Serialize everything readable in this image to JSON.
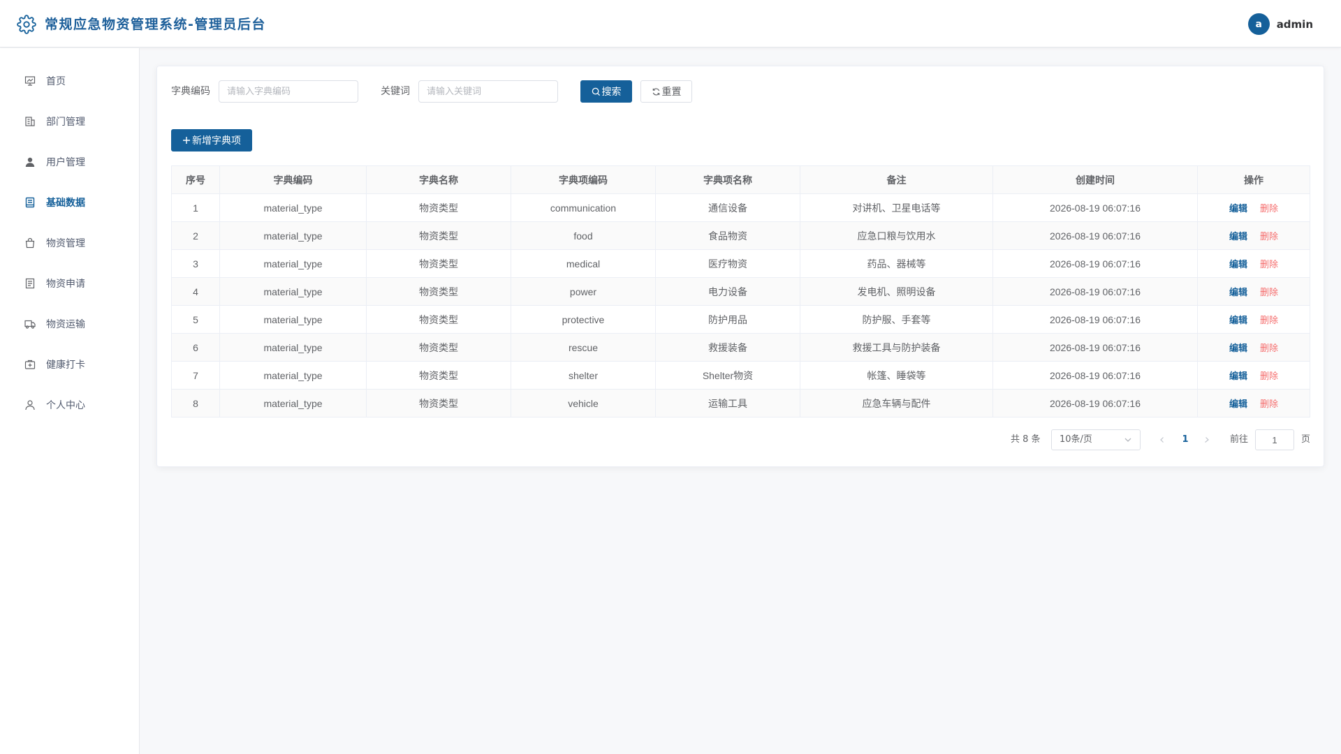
{
  "header": {
    "title": "常规应急物资管理系统-管理员后台",
    "avatar_letter": "a",
    "username": "admin"
  },
  "sidebar": {
    "items": [
      {
        "label": "首页",
        "icon": "presentation-chart-icon"
      },
      {
        "label": "部门管理",
        "icon": "building-icon"
      },
      {
        "label": "用户管理",
        "icon": "user-filled-icon"
      },
      {
        "label": "基础数据",
        "icon": "notebook-icon",
        "active": true
      },
      {
        "label": "物资管理",
        "icon": "shopping-bag-icon"
      },
      {
        "label": "物资申请",
        "icon": "document-icon"
      },
      {
        "label": "物资运输",
        "icon": "van-icon"
      },
      {
        "label": "健康打卡",
        "icon": "first-aid-kit-icon"
      },
      {
        "label": "个人中心",
        "icon": "user-icon"
      }
    ]
  },
  "search": {
    "code_label": "字典编码",
    "code_placeholder": "请输入字典编码",
    "keyword_label": "关键词",
    "keyword_placeholder": "请输入关键词",
    "search_button": "搜索",
    "reset_button": "重置"
  },
  "toolbar": {
    "add_button": "新增字典项"
  },
  "table": {
    "columns": [
      "序号",
      "字典编码",
      "字典名称",
      "字典项编码",
      "字典项名称",
      "备注",
      "创建时间",
      "操作"
    ],
    "edit_label": "编辑",
    "delete_label": "删除",
    "rows": [
      [
        "1",
        "material_type",
        "物资类型",
        "communication",
        "通信设备",
        "对讲机、卫星电话等",
        "2026-08-19 06:07:16"
      ],
      [
        "2",
        "material_type",
        "物资类型",
        "food",
        "食品物资",
        "应急口粮与饮用水",
        "2026-08-19 06:07:16"
      ],
      [
        "3",
        "material_type",
        "物资类型",
        "medical",
        "医疗物资",
        "药品、器械等",
        "2026-08-19 06:07:16"
      ],
      [
        "4",
        "material_type",
        "物资类型",
        "power",
        "电力设备",
        "发电机、照明设备",
        "2026-08-19 06:07:16"
      ],
      [
        "5",
        "material_type",
        "物资类型",
        "protective",
        "防护用品",
        "防护服、手套等",
        "2026-08-19 06:07:16"
      ],
      [
        "6",
        "material_type",
        "物资类型",
        "rescue",
        "救援装备",
        "救援工具与防护装备",
        "2026-08-19 06:07:16"
      ],
      [
        "7",
        "material_type",
        "物资类型",
        "shelter",
        "Shelter物资",
        "帐篷、睡袋等",
        "2026-08-19 06:07:16"
      ],
      [
        "8",
        "material_type",
        "物资类型",
        "vehicle",
        "运输工具",
        "应急车辆与配件",
        "2026-08-19 06:07:16"
      ]
    ]
  },
  "pagination": {
    "total_text": "共 8 条",
    "page_size": "10条/页",
    "current_page": "1",
    "goto_label": "前往",
    "goto_value": "1",
    "page_suffix": "页"
  },
  "colors": {
    "primary": "#15609a",
    "danger": "#f56c6c"
  }
}
